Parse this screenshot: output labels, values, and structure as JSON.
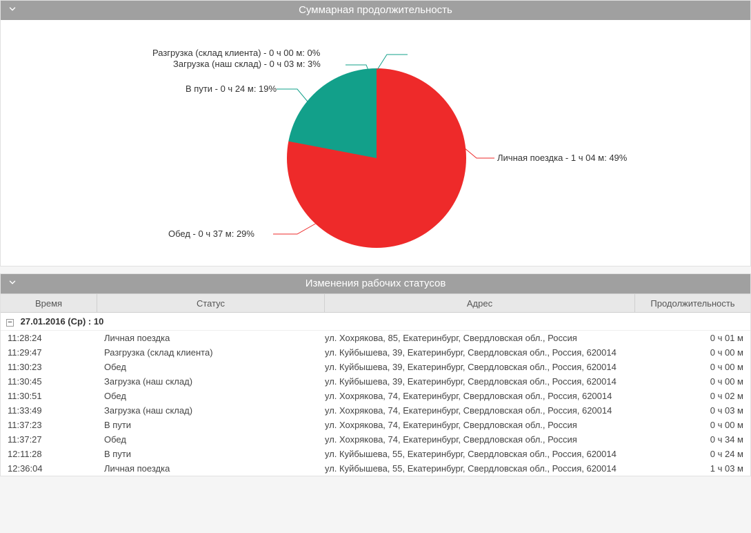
{
  "panel1": {
    "title": "Суммарная продолжительность"
  },
  "panel2": {
    "title": "Изменения рабочих статусов"
  },
  "chart_data": {
    "type": "pie",
    "title": "Суммарная продолжительность",
    "series": [
      {
        "name": "Личная поездка",
        "duration": "1 ч 04 м",
        "percent": 49,
        "label": "Личная поездка - 1 ч 04 м: 49%",
        "color": "#ee2a2a"
      },
      {
        "name": "Обед",
        "duration": "0 ч 37 м",
        "percent": 29,
        "label": "Обед - 0 ч 37 м: 29%",
        "color": "#ee2a2a"
      },
      {
        "name": "В пути",
        "duration": "0 ч 24 м",
        "percent": 19,
        "label": "В пути - 0 ч 24 м: 19%",
        "color": "#12a08a"
      },
      {
        "name": "Загрузка (наш склад)",
        "duration": "0 ч 03 м",
        "percent": 3,
        "label": "Загрузка (наш склад) - 0 ч 03 м: 3%",
        "color": "#12a08a"
      },
      {
        "name": "Разгрузка (склад клиента)",
        "duration": "0 ч 00 м",
        "percent": 0,
        "label": "Разгрузка (склад клиента) - 0 ч 00 м: 0%",
        "color": "#12a08a"
      }
    ]
  },
  "table": {
    "headers": {
      "time": "Время",
      "status": "Статус",
      "address": "Адрес",
      "duration": "Продолжительность"
    },
    "group": "27.01.2016 (Ср) : 10",
    "rows": [
      {
        "time": "11:28:24",
        "status": "Личная поездка",
        "address": "ул. Хохрякова, 85, Екатеринбург, Свердловская обл., Россия",
        "duration": "0 ч 01 м"
      },
      {
        "time": "11:29:47",
        "status": "Разгрузка (склад клиента)",
        "address": "ул. Куйбышева, 39, Екатеринбург, Свердловская обл., Россия, 620014",
        "duration": "0 ч 00 м"
      },
      {
        "time": "11:30:23",
        "status": "Обед",
        "address": "ул. Куйбышева, 39, Екатеринбург, Свердловская обл., Россия, 620014",
        "duration": "0 ч 00 м"
      },
      {
        "time": "11:30:45",
        "status": "Загрузка (наш склад)",
        "address": "ул. Куйбышева, 39, Екатеринбург, Свердловская обл., Россия, 620014",
        "duration": "0 ч 00 м"
      },
      {
        "time": "11:30:51",
        "status": "Обед",
        "address": "ул. Хохрякова, 74, Екатеринбург, Свердловская обл., Россия, 620014",
        "duration": "0 ч 02 м"
      },
      {
        "time": "11:33:49",
        "status": "Загрузка (наш склад)",
        "address": "ул. Хохрякова, 74, Екатеринбург, Свердловская обл., Россия, 620014",
        "duration": "0 ч 03 м"
      },
      {
        "time": "11:37:23",
        "status": "В пути",
        "address": "ул. Хохрякова, 74, Екатеринбург, Свердловская обл., Россия",
        "duration": "0 ч 00 м"
      },
      {
        "time": "11:37:27",
        "status": "Обед",
        "address": "ул. Хохрякова, 74, Екатеринбург, Свердловская обл., Россия",
        "duration": "0 ч 34 м"
      },
      {
        "time": "12:11:28",
        "status": "В пути",
        "address": "ул. Куйбышева, 55, Екатеринбург, Свердловская обл., Россия, 620014",
        "duration": "0 ч 24 м"
      },
      {
        "time": "12:36:04",
        "status": "Личная поездка",
        "address": "ул. Куйбышева, 55, Екатеринбург, Свердловская обл., Россия, 620014",
        "duration": "1 ч 03 м"
      }
    ]
  }
}
